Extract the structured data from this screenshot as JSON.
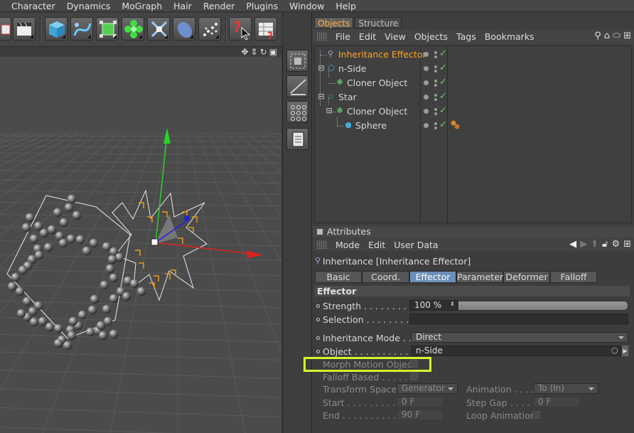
{
  "menubar": [
    "Character",
    "Dynamics",
    "MoGraph",
    "Hair",
    "Render",
    "Plugins",
    "Window",
    "Help"
  ],
  "object_manager": {
    "tabs": [
      "Objects",
      "Structure"
    ],
    "menu": [
      "File",
      "Edit",
      "View",
      "Objects",
      "Tags",
      "Bookmarks"
    ],
    "objects": [
      {
        "name": "Inheritance Effector",
        "selected": true
      },
      {
        "name": "n-Side",
        "selected": false
      },
      {
        "name": "Cloner Object",
        "selected": false
      },
      {
        "name": "Star",
        "selected": false
      },
      {
        "name": "Cloner Object",
        "selected": false
      },
      {
        "name": "Sphere",
        "selected": false
      }
    ]
  },
  "attributes": {
    "title": "Attributes",
    "menu": [
      "Mode",
      "Edit",
      "User Data"
    ],
    "object_name": "Inheritance [Inheritance Effector]",
    "tabs": [
      "Basic",
      "Coord.",
      "Effector",
      "Parameter",
      "Deformer",
      "Falloff"
    ],
    "active_tab": "Effector",
    "section": "Effector",
    "strength_label": "Strength . . . . . . . . . . . .",
    "strength_value": "100 %",
    "strength_level": 1.0,
    "selection_label": "Selection . . . . . . . . . . .",
    "inheritance_mode_label": "Inheritance Mode . . .",
    "inheritance_mode_value": "Direct",
    "object_label": "Object . . . . . . . . . . . . . .",
    "object_value": "n-Side",
    "morph_motion_label": "Morph Motion Object",
    "falloff_based_label": "Falloff Based . . . . . . .",
    "transform_space_label": "Transform Space",
    "transform_space_value": "Generator",
    "animation_label": "Animation . . . . .",
    "animation_value": "To (In)",
    "start_label": "Start . . . . . . . . . . . . .",
    "start_value": "0 F",
    "step_gap_label": "Step Gap . . . . . .",
    "step_gap_value": "0 F",
    "end_label": "End . . . . . . . . . . . . . .",
    "end_value": "90 F",
    "loop_animation_label": "Loop Animation"
  },
  "colors": {
    "selected_object": "#ffa42a",
    "active_tab": "#6b8fb8",
    "highlight_box": "#d8f52a",
    "check_green": "#5ad85a"
  }
}
